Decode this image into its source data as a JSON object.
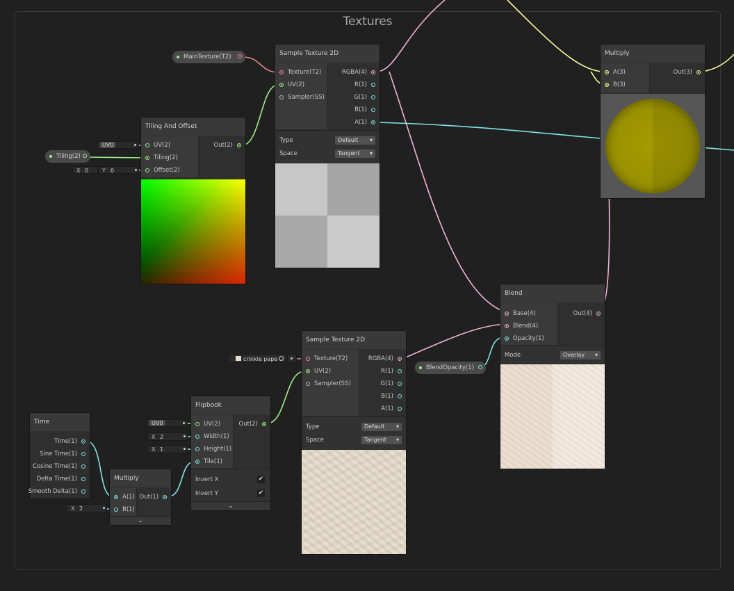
{
  "group": {
    "title": "Textures"
  },
  "properties": {
    "main_texture": "MainTexture(T2)",
    "tiling": "Tiling(2)",
    "blend_opacity": "BlendOpacity(1)"
  },
  "sample_tex_top": {
    "title": "Sample Texture 2D",
    "inputs": [
      "Texture(T2)",
      "UV(2)",
      "Sampler(SS)"
    ],
    "outputs": [
      "RGBA(4)",
      "R(1)",
      "G(1)",
      "B(1)",
      "A(1)"
    ],
    "type_label": "Type",
    "type_value": "Default",
    "space_label": "Space",
    "space_value": "Tangent"
  },
  "tiling_offset": {
    "title": "Tiling And Offset",
    "inputs": [
      "UV(2)",
      "Tiling(2)",
      "Offset(2)"
    ],
    "outputs": [
      "Out(2)"
    ],
    "uv_channel": "UV0",
    "offset_x_label": "X",
    "offset_x": "0",
    "offset_y_label": "Y",
    "offset_y": "0"
  },
  "multiply_top": {
    "title": "Multiply",
    "inputs": [
      "A(3)",
      "B(3)"
    ],
    "outputs": [
      "Out(3)"
    ]
  },
  "blend": {
    "title": "Blend",
    "inputs": [
      "Base(4)",
      "Blend(4)",
      "Opacity(1)"
    ],
    "outputs": [
      "Out(4)"
    ],
    "mode_label": "Mode",
    "mode_value": "Overlay"
  },
  "sample_tex_bottom": {
    "title": "Sample Texture 2D",
    "inputs": [
      "Texture(T2)",
      "UV(2)",
      "Sampler(SS)"
    ],
    "outputs": [
      "RGBA(4)",
      "R(1)",
      "G(1)",
      "B(1)",
      "A(1)"
    ],
    "texture_asset": "crinkle pape",
    "type_label": "Type",
    "type_value": "Default",
    "space_label": "Space",
    "space_value": "Tangent"
  },
  "time": {
    "title": "Time",
    "outputs": [
      "Time(1)",
      "Sine Time(1)",
      "Cosine Time(1)",
      "Delta Time(1)",
      "Smooth Delta(1)"
    ]
  },
  "multiply_bottom": {
    "title": "Multiply",
    "inputs": [
      "A(1)",
      "B(1)"
    ],
    "outputs": [
      "Out(1)"
    ],
    "b_x_label": "X",
    "b_x": "2"
  },
  "flipbook": {
    "title": "Flipbook",
    "inputs": [
      "UV(2)",
      "Width(1)",
      "Height(1)",
      "Tile(1)"
    ],
    "outputs": [
      "Out(2)"
    ],
    "uv_channel": "UV0",
    "width_label": "X",
    "width": "2",
    "height_label": "X",
    "height": "1",
    "invert_x": "Invert X",
    "invert_y": "Invert Y",
    "check_mark": "✔"
  },
  "icons": {
    "collapse": "chevron-down-icon",
    "texture_swatch": "texture-icon"
  },
  "colors": {
    "texture": "#f08aa4",
    "vector2": "#9ef08a",
    "vector3": "#f6ff9a",
    "vector4": "#f3b2d8",
    "float": "#84e4e7",
    "background": "#202020"
  },
  "chevron": "⌄"
}
